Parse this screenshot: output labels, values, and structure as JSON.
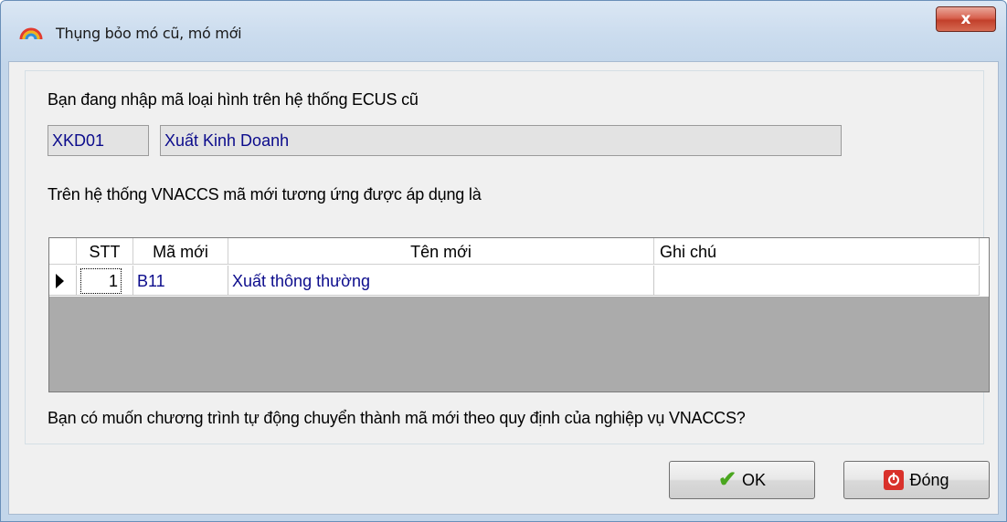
{
  "window": {
    "title": "Thụng bỏo mó cũ, mó mới",
    "close_label": "x"
  },
  "old_system": {
    "label": "Bạn đang nhập mã loại hình trên hệ thống ECUS cũ",
    "code": "XKD01",
    "name": "Xuất Kinh Doanh"
  },
  "new_system": {
    "label": "Trên hệ thống VNACCS mã mới tương ứng được áp dụng là"
  },
  "grid": {
    "headers": {
      "stt": "STT",
      "new_code": "Mã mới",
      "new_name": "Tên mới",
      "note": "Ghi chú"
    },
    "rows": [
      {
        "stt": "1",
        "new_code": "B11",
        "new_name": "Xuất thông thường",
        "note": ""
      }
    ]
  },
  "question": "Bạn có muốn chương trình tự động chuyển thành mã mới theo quy định của nghiệp vụ VNACCS?",
  "buttons": {
    "ok_label": "OK",
    "close_label": "Đóng"
  },
  "icons": {
    "app": "rainbow-arc-icon",
    "ok": "checkmark-icon",
    "close": "power-icon"
  },
  "colors": {
    "value_text": "#0c0c8c",
    "title_close": "#c2402b",
    "ok_check": "#4aa61f"
  }
}
